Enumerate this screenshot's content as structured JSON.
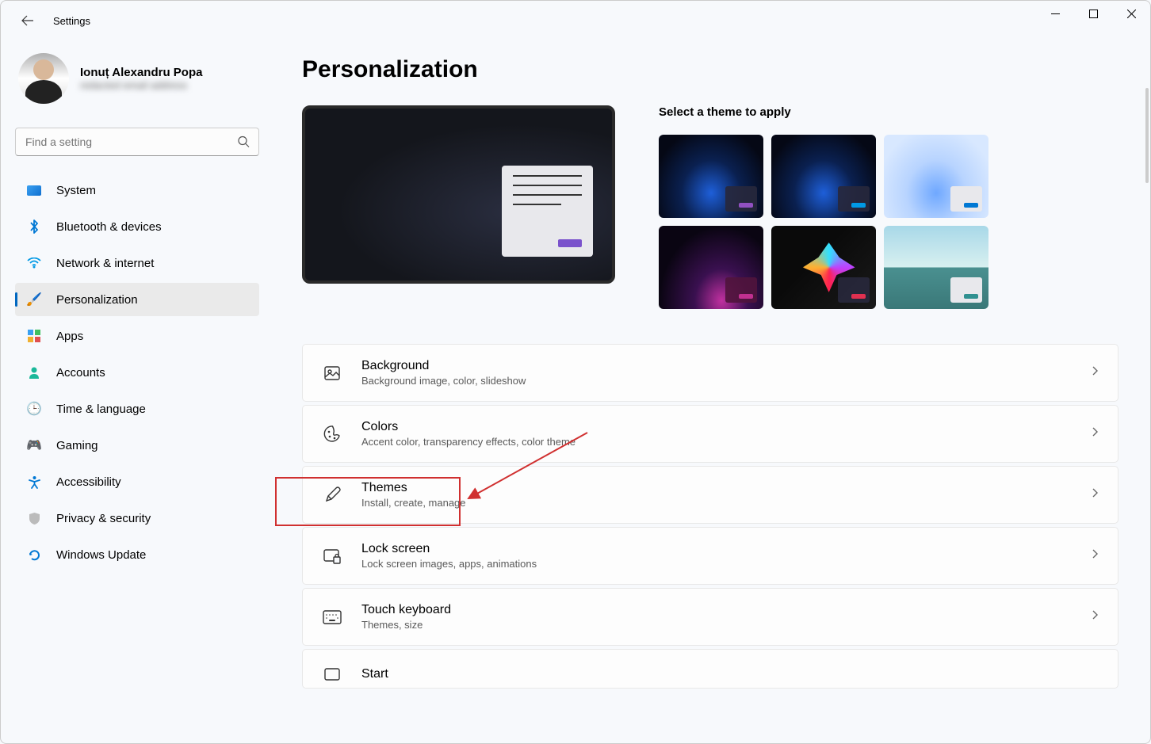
{
  "app_title": "Settings",
  "user": {
    "name": "Ionuț Alexandru Popa",
    "email": "redacted email address"
  },
  "search": {
    "placeholder": "Find a setting"
  },
  "nav": [
    {
      "label": "System"
    },
    {
      "label": "Bluetooth & devices"
    },
    {
      "label": "Network & internet"
    },
    {
      "label": "Personalization"
    },
    {
      "label": "Apps"
    },
    {
      "label": "Accounts"
    },
    {
      "label": "Time & language"
    },
    {
      "label": "Gaming"
    },
    {
      "label": "Accessibility"
    },
    {
      "label": "Privacy & security"
    },
    {
      "label": "Windows Update"
    }
  ],
  "page": {
    "title": "Personalization",
    "theme_header": "Select a theme to apply",
    "items": [
      {
        "title": "Background",
        "sub": "Background image, color, slideshow"
      },
      {
        "title": "Colors",
        "sub": "Accent color, transparency effects, color theme"
      },
      {
        "title": "Themes",
        "sub": "Install, create, manage"
      },
      {
        "title": "Lock screen",
        "sub": "Lock screen images, apps, animations"
      },
      {
        "title": "Touch keyboard",
        "sub": "Themes, size"
      },
      {
        "title": "Start",
        "sub": ""
      }
    ]
  }
}
